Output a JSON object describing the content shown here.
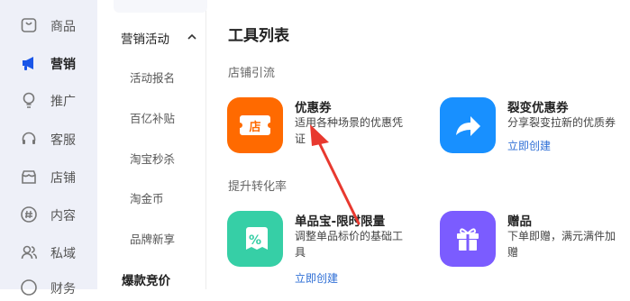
{
  "sidebar": {
    "items": [
      {
        "label": "商品",
        "icon": "product-icon"
      },
      {
        "label": "营销",
        "icon": "megaphone-icon",
        "active": true
      },
      {
        "label": "推广",
        "icon": "lightbulb-icon"
      },
      {
        "label": "客服",
        "icon": "headset-icon"
      },
      {
        "label": "店铺",
        "icon": "store-icon"
      },
      {
        "label": "内容",
        "icon": "hashtag-icon"
      },
      {
        "label": "私域",
        "icon": "users-icon"
      },
      {
        "label": "财务",
        "icon": "finance-icon"
      }
    ]
  },
  "subnav": {
    "header": "营销活动",
    "items": [
      "活动报名",
      "百亿补贴",
      "淘宝秒杀",
      "淘金币",
      "品牌新享"
    ],
    "bottom": "爆款竞价"
  },
  "main": {
    "title": "工具列表",
    "sections": [
      {
        "title": "店铺引流"
      },
      {
        "title": "提升转化率"
      }
    ],
    "tools": [
      {
        "name": "优惠券",
        "desc": "适用各种场景的优惠凭证",
        "link": "",
        "icon": "coupon-icon",
        "icon_text": "店",
        "color": "#ff6a00"
      },
      {
        "name": "裂变优惠券",
        "desc": "分享裂变拉新的优质券",
        "link": "立即创建",
        "icon": "share-arrow-icon",
        "color": "#1890ff"
      },
      {
        "name": "单品宝-限时限量",
        "desc": "调整单品标价的基础工具",
        "link": "立即创建",
        "icon": "percent-tag-icon",
        "color": "#36cfa6"
      },
      {
        "name": "赠品",
        "desc": "下单即赠，满元满件加赠",
        "link": "",
        "icon": "gift-icon",
        "color": "#7b5cff"
      }
    ]
  },
  "annotation": {
    "arrow_color": "#e8392f"
  }
}
